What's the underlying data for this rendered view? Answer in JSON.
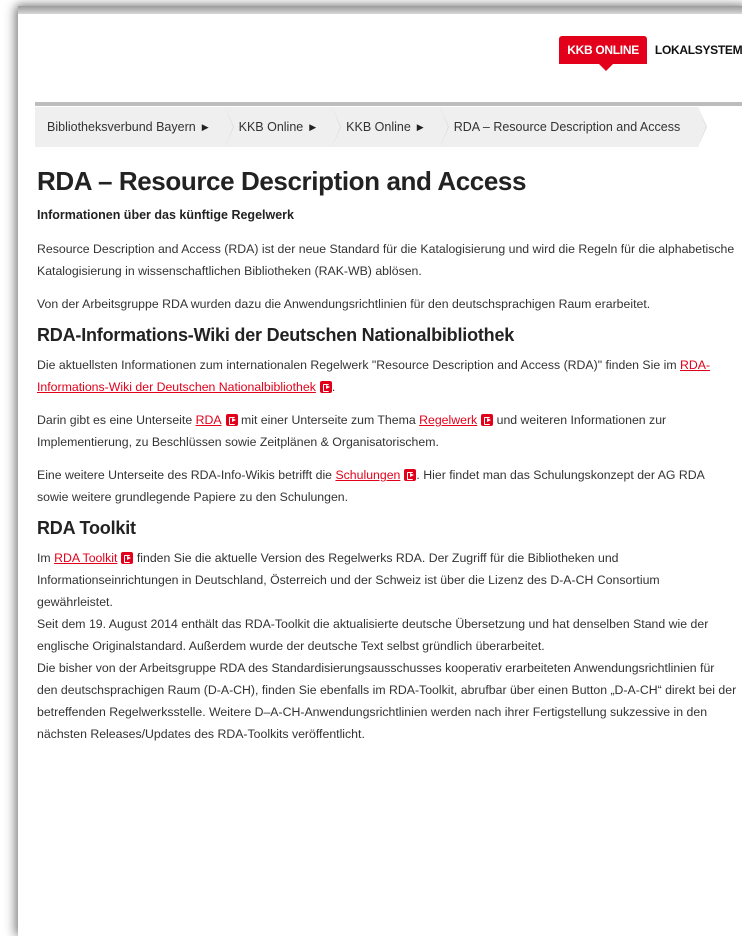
{
  "nav": {
    "active": "KKB ONLINE",
    "second": "LOKALSYSTEME"
  },
  "breadcrumb": [
    "Bibliotheksverbund Bayern",
    "KKB Online",
    "KKB Online",
    "RDA – Resource Description and Access"
  ],
  "page": {
    "title": "RDA – Resource Description and Access",
    "subtitle": "Informationen über das künftige Regelwerk",
    "intro1": "Resource Description and Access (RDA) ist der neue Standard für die Katalogisierung und wird die Regeln für die alphabetische Katalogisierung in wissenschaftlichen Bibliotheken (RAK-WB) ablösen.",
    "intro2": "Von der Arbeitsgruppe RDA wurden dazu die Anwendungsrichtlinien für den deutschsprachigen Raum erarbeitet."
  },
  "wiki": {
    "heading": "RDA-Informations-Wiki der Deutschen Nationalbibliothek",
    "p1_before": "Die aktuellsten Informationen zum internationalen Regelwerk \"Resource Description and Access (RDA)\" finden Sie im ",
    "p1_link": "RDA-Informations-Wiki der Deutschen Nationalbibliothek",
    "p1_after": ".",
    "p2_a": "Darin gibt es eine Unterseite ",
    "p2_link1": "RDA",
    "p2_b": " mit einer Unterseite zum Thema ",
    "p2_link2": "Regelwerk",
    "p2_c": " und weiteren Informationen zur Implementierung, zu Beschlüssen sowie Zeitplänen & Organisatorischem.",
    "p3_a": "Eine weitere Unterseite des RDA-Info-Wikis betrifft die ",
    "p3_link": "Schulungen",
    "p3_b": ". Hier findet man das Schulungskonzept der AG RDA sowie weitere grundlegende Papiere zu den Schulungen."
  },
  "toolkit": {
    "heading": "RDA Toolkit",
    "p_a": "Im ",
    "p_link": "RDA Toolkit",
    "p_b": " finden Sie die aktuelle Version des Regelwerks RDA. Der Zugriff für die Bibliotheken und Informationseinrichtungen in Deutschland, Österreich und der Schweiz ist über die Lizenz des D-A-CH Consortium gewährleistet.",
    "p2": "Seit dem 19. August 2014 enthält das RDA-Toolkit die aktualisierte deutsche Übersetzung und hat denselben Stand wie der englische Originalstandard. Außerdem wurde der deutsche Text selbst gründlich überarbeitet.",
    "p3": "Die bisher von der Arbeitsgruppe RDA des Standardisierungsausschusses kooperativ erarbeiteten Anwendungsrichtlinien für den deutschsprachigen Raum (D-A-CH), finden Sie ebenfalls im RDA-Toolkit, abrufbar über einen Button „D-A-CH“ direkt bei der betreffenden Regelwerksstelle. Weitere D–A-CH-Anwendungsrichtlinien werden nach ihrer Fertigstellung sukzessive in den nächsten Releases/Updates des RDA-Toolkits veröffentlicht."
  },
  "icons": {
    "breadcrumb_separator": "triangle-right-icon",
    "external_link": "external-link-icon"
  },
  "colors": {
    "accent": "#e2001a",
    "breadcrumb_bg": "#efefef"
  }
}
